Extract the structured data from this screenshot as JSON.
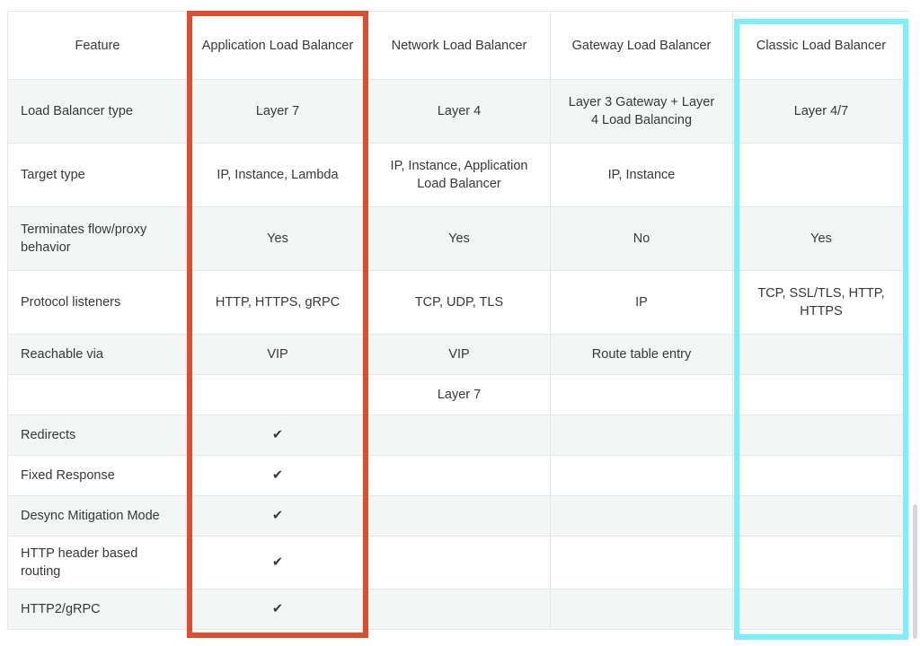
{
  "table": {
    "columns": [
      {
        "id": "feature",
        "label": "Feature"
      },
      {
        "id": "alb",
        "label": "Application Load Balancer"
      },
      {
        "id": "nlb",
        "label": "Network Load Balancer"
      },
      {
        "id": "gwlb",
        "label": "Gateway Load Balancer"
      },
      {
        "id": "clb",
        "label": "Classic Load Balancer"
      }
    ],
    "rows": [
      {
        "feature": "Load Balancer type",
        "alb": "Layer 7",
        "nlb": "Layer 4",
        "gwlb": "Layer 3 Gateway + Layer 4 Load Balancing",
        "clb": "Layer 4/7"
      },
      {
        "feature": "Target type",
        "alb": "IP, Instance, Lambda",
        "nlb": "IP, Instance, Application Load Balancer",
        "gwlb": "IP, Instance",
        "clb": ""
      },
      {
        "feature": "Terminates flow/proxy behavior",
        "alb": "Yes",
        "nlb": "Yes",
        "gwlb": "No",
        "clb": "Yes"
      },
      {
        "feature": "Protocol listeners",
        "alb": "HTTP, HTTPS, gRPC",
        "nlb": "TCP, UDP, TLS",
        "gwlb": "IP",
        "clb": "TCP, SSL/TLS, HTTP, HTTPS"
      },
      {
        "feature": "Reachable via",
        "alb": "VIP",
        "nlb": "VIP",
        "gwlb": "Route table entry",
        "clb": ""
      }
    ],
    "section_header": {
      "feature": "",
      "alb": "",
      "nlb": "Layer 7",
      "gwlb": "",
      "clb": ""
    },
    "feature_rows": [
      {
        "feature": "Redirects",
        "alb": "✔",
        "nlb": "",
        "gwlb": "",
        "clb": ""
      },
      {
        "feature": "Fixed Response",
        "alb": "✔",
        "nlb": "",
        "gwlb": "",
        "clb": ""
      },
      {
        "feature": "Desync Mitigation Mode",
        "alb": "✔",
        "nlb": "",
        "gwlb": "",
        "clb": ""
      },
      {
        "feature": "HTTP header based routing",
        "alb": "✔",
        "nlb": "",
        "gwlb": "",
        "clb": ""
      },
      {
        "feature": "HTTP2/gRPC",
        "alb": "✔",
        "nlb": "",
        "gwlb": "",
        "clb": ""
      }
    ]
  },
  "annotations": {
    "alb_highlight": {
      "label": "Application Load Balancer column highlight",
      "color": "#de4d2e"
    },
    "clb_highlight": {
      "label": "Classic Load Balancer column highlight",
      "color": "#7cefFA"
    }
  }
}
